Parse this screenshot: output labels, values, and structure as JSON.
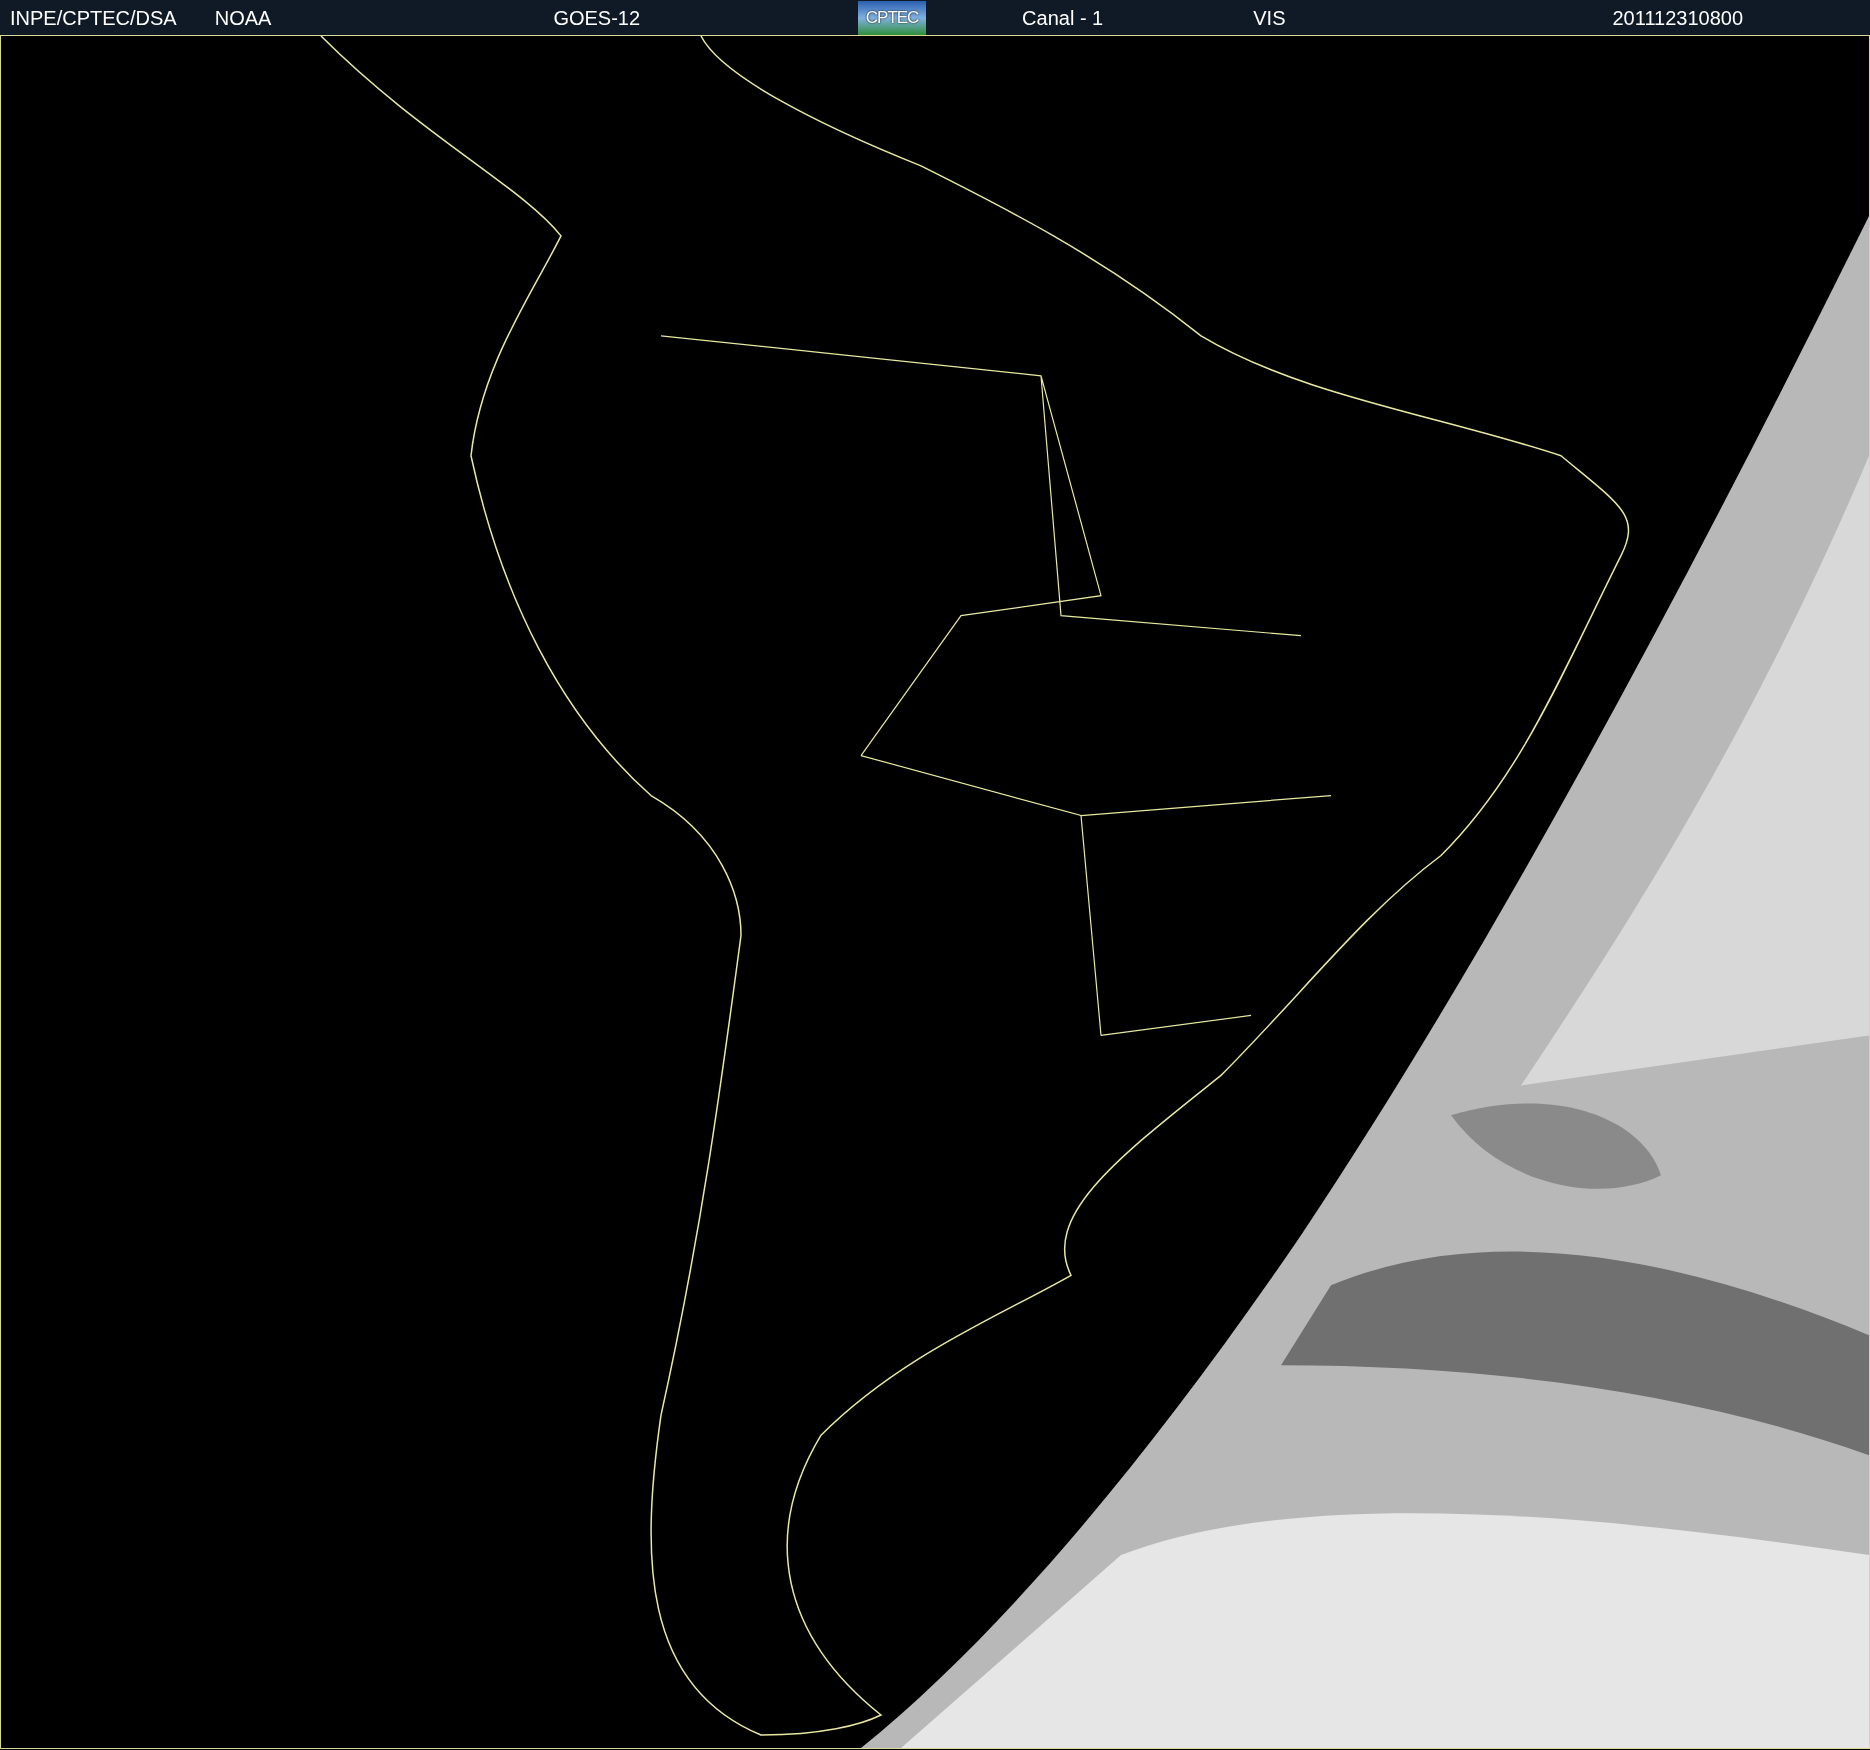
{
  "header": {
    "items": [
      {
        "kind": "text",
        "text": "INPE/CPTEC/DSA"
      },
      {
        "kind": "text",
        "text": "NOAA"
      },
      {
        "kind": "text",
        "text": "GOES-12"
      },
      {
        "kind": "logo",
        "text": "CPTEC"
      },
      {
        "kind": "text",
        "text": "Canal - 1"
      },
      {
        "kind": "text",
        "text": "VIS"
      },
      {
        "kind": "text",
        "text": "201112310800"
      }
    ]
  }
}
